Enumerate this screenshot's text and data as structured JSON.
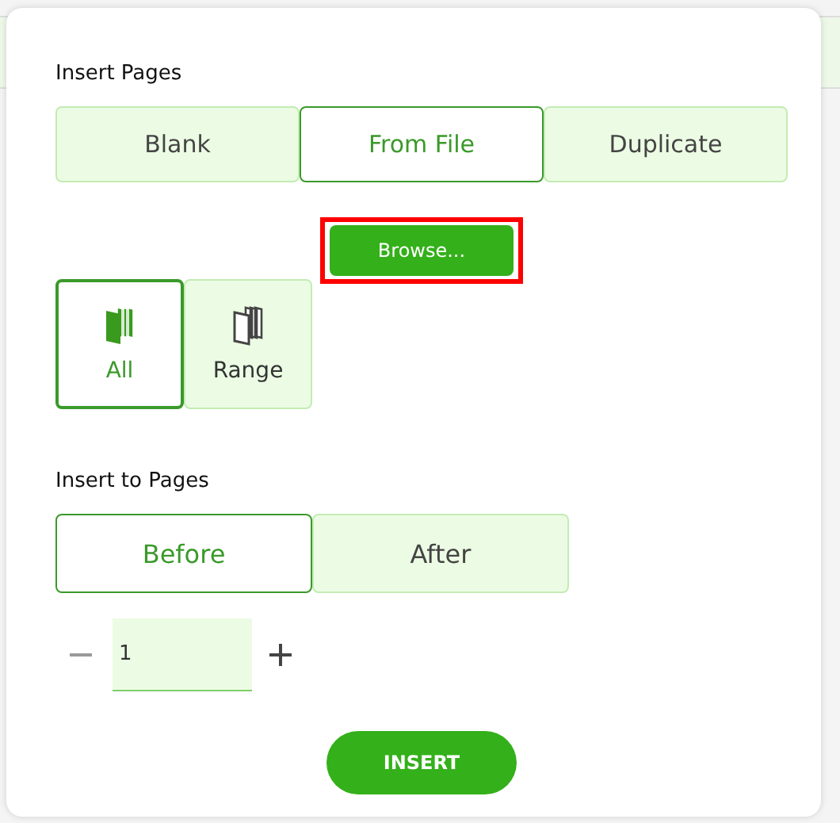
{
  "insert_pages": {
    "label": "Insert Pages",
    "sources": [
      {
        "label": "Blank",
        "selected": false
      },
      {
        "label": "From File",
        "selected": true
      },
      {
        "label": "Duplicate",
        "selected": false
      }
    ],
    "browse_button": {
      "label": "Browse...",
      "highlighted": true
    },
    "page_modes": [
      {
        "label": "All",
        "selected": true,
        "kind": "all"
      },
      {
        "label": "Range",
        "selected": false,
        "kind": "range"
      }
    ]
  },
  "insert_to_pages": {
    "label": "Insert to Pages",
    "positions": [
      {
        "label": "Before",
        "selected": true
      },
      {
        "label": "After",
        "selected": false
      }
    ],
    "stepper": {
      "value": "1",
      "minus_disabled": true,
      "plus_disabled": false
    }
  },
  "insert_button": "INSERT"
}
